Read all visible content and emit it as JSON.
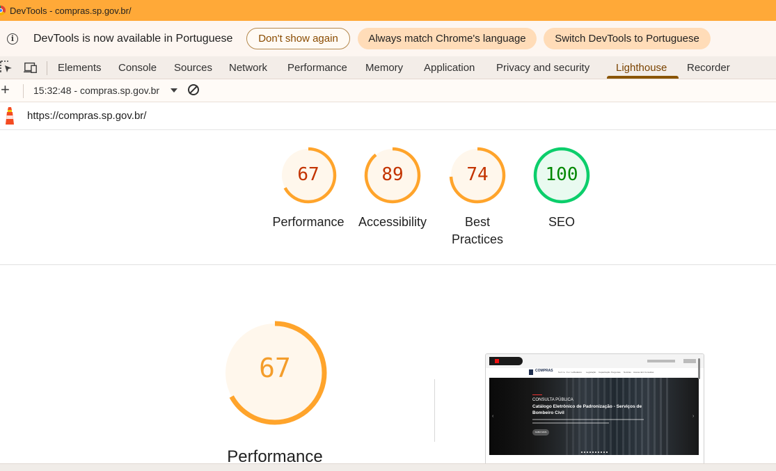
{
  "window": {
    "title": "DevTools - compras.sp.gov.br/"
  },
  "infobar": {
    "message": "DevTools is now available in Portuguese",
    "dont_show": "Don't show again",
    "always_match": "Always match Chrome's language",
    "switch": "Switch DevTools to Portuguese"
  },
  "tabs": [
    "Elements",
    "Console",
    "Sources",
    "Network",
    "Performance",
    "Memory",
    "Application",
    "Privacy and security",
    "Lighthouse",
    "Recorder"
  ],
  "active_tab": "Lighthouse",
  "toolbar": {
    "report_selector": "15:32:48 - compras.sp.gov.br"
  },
  "url": "https://compras.sp.gov.br/",
  "scores": [
    {
      "value": "67",
      "label": "Performance",
      "score": 67,
      "status": "average"
    },
    {
      "value": "89",
      "label": "Accessibility",
      "score": 89,
      "status": "average"
    },
    {
      "value": "74",
      "label": "Best Practices",
      "label_line1": "Best",
      "label_line2": "Practices",
      "score": 74,
      "status": "average"
    },
    {
      "value": "100",
      "label": "SEO",
      "score": 100,
      "status": "pass"
    }
  ],
  "performance_section": {
    "score": "67",
    "score_fraction": 0.67,
    "label": "Performance"
  },
  "thumbnail": {
    "logo_text": "COMPRAS",
    "nav_items": [
      "Sobre Fornec",
      "Cadastro",
      "Legislação",
      "Capacitação",
      "Perguntas",
      "Notícias",
      "Acesso Ent",
      "Consultas"
    ],
    "kicker": "CONSULTA PÚBLICA",
    "headline_line1": "Catálogo Eletrônico de Padronização - Serviços de",
    "headline_line2": "Bombeiro Civil",
    "cta": "SAIBA MAIS"
  },
  "colors": {
    "titlebar": "#ffa938",
    "average_stroke": "#ffa42b",
    "average_text": "#c33300",
    "average_fill": "#fff7ec",
    "pass_stroke": "#0cce6b",
    "pass_text": "#008800",
    "pass_fill": "#e9faf0",
    "tab_active": "#7a4300"
  }
}
